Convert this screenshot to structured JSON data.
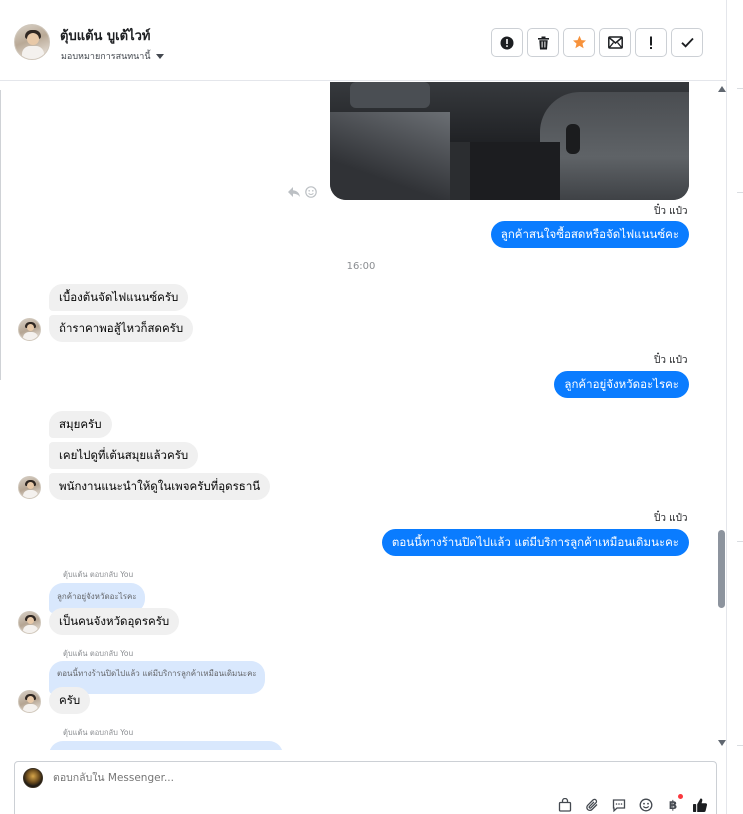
{
  "header": {
    "contact_name": "ตุ้บแต้น บูเต้ไวท์",
    "assign_label": "มอบหมายการสนทนานี้",
    "actions": [
      {
        "name": "report-button",
        "icon": "alert-circle-icon"
      },
      {
        "name": "delete-button",
        "icon": "trash-icon"
      },
      {
        "name": "star-button",
        "icon": "star-icon",
        "color": "#f7923b"
      },
      {
        "name": "mark-unread-button",
        "icon": "envelope-icon"
      },
      {
        "name": "spam-button",
        "icon": "exclamation-icon"
      },
      {
        "name": "done-button",
        "icon": "check-icon"
      }
    ]
  },
  "conversation": {
    "time_divider": "16:00",
    "messages": [
      {
        "sender": "ปิ๋ว แป๋ว",
        "text": "ลูกค้าสนใจซื้อสดหรือจัดไฟแนนซ์คะ",
        "direction": "out"
      },
      {
        "text": "เบื้องต้นจัดไฟแนนซ์ครับ",
        "direction": "in"
      },
      {
        "text": "ถ้าราคาพอสู้ไหวก็สดครับ",
        "direction": "in"
      },
      {
        "sender": "ปิ๋ว แป๋ว",
        "text": "ลูกค้าอยู่จังหวัดอะไรคะ",
        "direction": "out"
      },
      {
        "text": "สมุยครับ",
        "direction": "in"
      },
      {
        "text": "เคยไปดูที่เต้นสมุยแล้วครับ",
        "direction": "in"
      },
      {
        "text": "พนักงานแนะนำให้ดูในเพจครับที่อุดรธานี",
        "direction": "in"
      },
      {
        "sender": "ปิ๋ว แป๋ว",
        "text": "ตอนนี้ทางร้านปิดไปแล้ว แต่มีบริการลูกค้าเหมือนเดิมนะคะ",
        "direction": "out"
      },
      {
        "reply_hint": "ตุ้บแต้น ตอบกลับ You",
        "quoted": "ลูกค้าอยู่จังหวัดอะไรคะ",
        "text": "เป็นคนจังหวัดอุดรครับ",
        "direction": "in"
      },
      {
        "reply_hint": "ตุ้บแต้น ตอบกลับ You",
        "quoted": "ตอนนี้ทางร้านปิดไปแล้ว แต่มีบริการลูกค้าเหมือนเดิมนะคะ",
        "text": "ครับ",
        "direction": "in"
      },
      {
        "reply_hint": "ตุ้บแต้น ตอบกลับ You",
        "direction": "in"
      }
    ]
  },
  "composer": {
    "placeholder": "ตอบกลับใน Messenger...",
    "tools": [
      "bag-icon",
      "paperclip-icon",
      "saved-reply-icon",
      "emoji-icon",
      "baht-icon",
      "thumbs-up-icon"
    ],
    "baht_symbol": "฿"
  },
  "colors": {
    "outgoing_bubble": "#0a7cff",
    "incoming_bubble": "#f0f0f0",
    "quote_bubble": "#d9e8fd",
    "star": "#f7923b"
  }
}
